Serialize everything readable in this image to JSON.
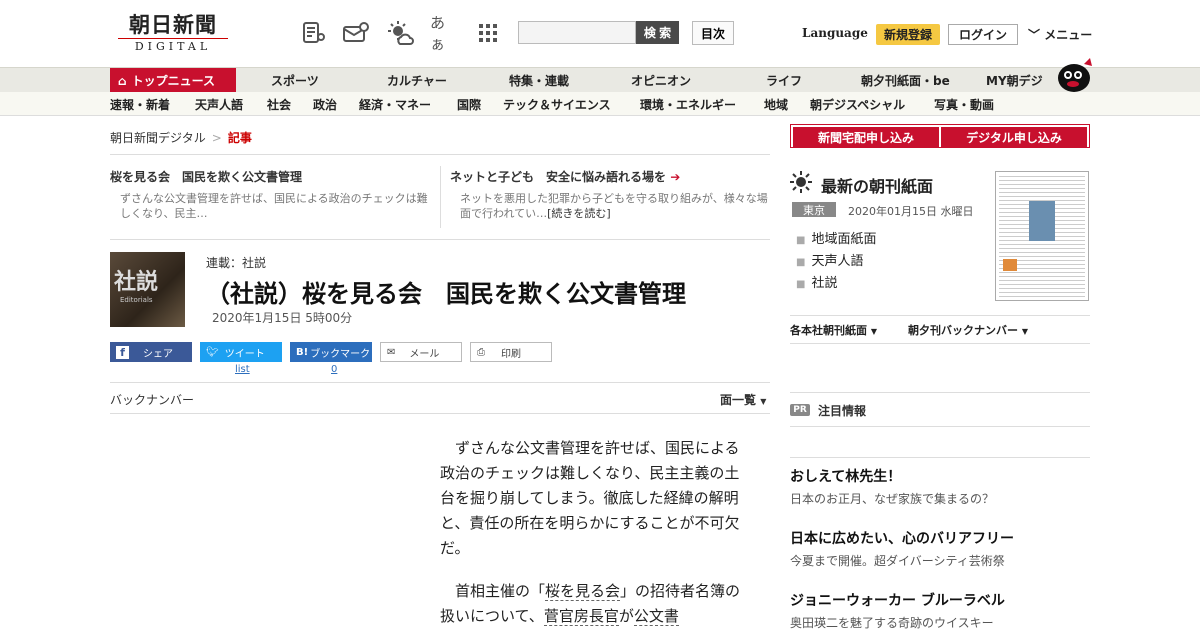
{
  "header": {
    "logo_main": "朝日新聞",
    "logo_sub": "DIGITAL",
    "font_size_icon_label": "あぁ",
    "search_placeholder": "",
    "search_button": "検 索",
    "toc_button": "目次",
    "language": "Language",
    "register": "新規登録",
    "login": "ログイン",
    "menu": "メニュー"
  },
  "nav_primary": [
    "トップニュース",
    "スポーツ",
    "カルチャー",
    "特集・連載",
    "オピニオン",
    "ライフ",
    "朝夕刊紙面・be",
    "MY朝デジ"
  ],
  "nav_secondary": [
    "速報・新着",
    "天声人語",
    "社会",
    "政治",
    "経済・マネー",
    "国際",
    "テック＆サイエンス",
    "環境・エネルギー",
    "地域",
    "朝デジスペシャル",
    "写真・動画"
  ],
  "breadcrumb": {
    "home": "朝日新聞デジタル",
    "sep": ">",
    "current": "記事"
  },
  "teasers": [
    {
      "title": "桜を見る会　国民を欺く公文書管理",
      "summary": "ずさんな公文書管理を許せば、国民による政治のチェックは難しくなり、民主…"
    },
    {
      "title": "ネットと子ども　安全に悩み語れる場を",
      "arrow": "➔",
      "summary": "ネットを悪用した犯罪から子どもを守る取り組みが、様々な場面で行われてい…",
      "more": "[続きを読む]"
    }
  ],
  "article": {
    "thumb_big": "社説",
    "thumb_small": "Editorials",
    "series": "連載：社説",
    "headline": "（社説）桜を見る会　国民を欺く公文書管理",
    "date": "2020年1月15日 5時00分",
    "share": {
      "facebook": "シェア",
      "twitter": "ツイート",
      "hatena": "ブックマーク",
      "mail": "メール",
      "print": "印刷",
      "twitter_count": "list",
      "hatena_count": "0",
      "hatena_logo": "B!"
    },
    "backnumber": "バックナンバー",
    "menlist": "面一覧",
    "p1": "ずさんな公文書管理を許せば、国民による政治のチェックは難しくなり、民主主義の土台を掘り崩してしまう。徹底した経緯の解明と、責任の所在を明らかにすることが不可欠だ。",
    "p2a": "首相主催の「",
    "p2_link1": "桜を見る会",
    "p2b": "」の招待者名簿の扱いについて、",
    "p2_link2": "菅官房長官",
    "p2c": "が",
    "p2_link3": "公文書"
  },
  "right": {
    "sub_home": "新聞宅配申し込み",
    "sub_digital": "デジタル申し込み",
    "latest_title": "最新の朝刊紙面",
    "edition": "東京",
    "paper_date": "2020年01月15日 水曜日",
    "links": [
      "地域面紙面",
      "天声人語",
      "社説"
    ],
    "link_honsha": "各本社朝刊紙面",
    "link_back": "朝夕刊バックナンバー",
    "pr_badge": "PR",
    "pr_title": "注目情報",
    "promos": [
      {
        "title": "おしえて林先生！",
        "sub": "日本のお正月、なぜ家族で集まるの？"
      },
      {
        "title": "日本に広めたい、心のバリアフリー",
        "sub": "今夏まで開催。超ダイバーシティ芸術祭"
      },
      {
        "title": "ジョニーウォーカー ブルーラベル",
        "sub": "奥田瑛二を魅了する奇跡のウイスキー"
      }
    ]
  },
  "colors": {
    "brand_red": "#c8102e",
    "register_yellow": "#f5c842",
    "facebook": "#3b5998",
    "twitter": "#1da1f2",
    "hatena": "#2c6ebd"
  }
}
